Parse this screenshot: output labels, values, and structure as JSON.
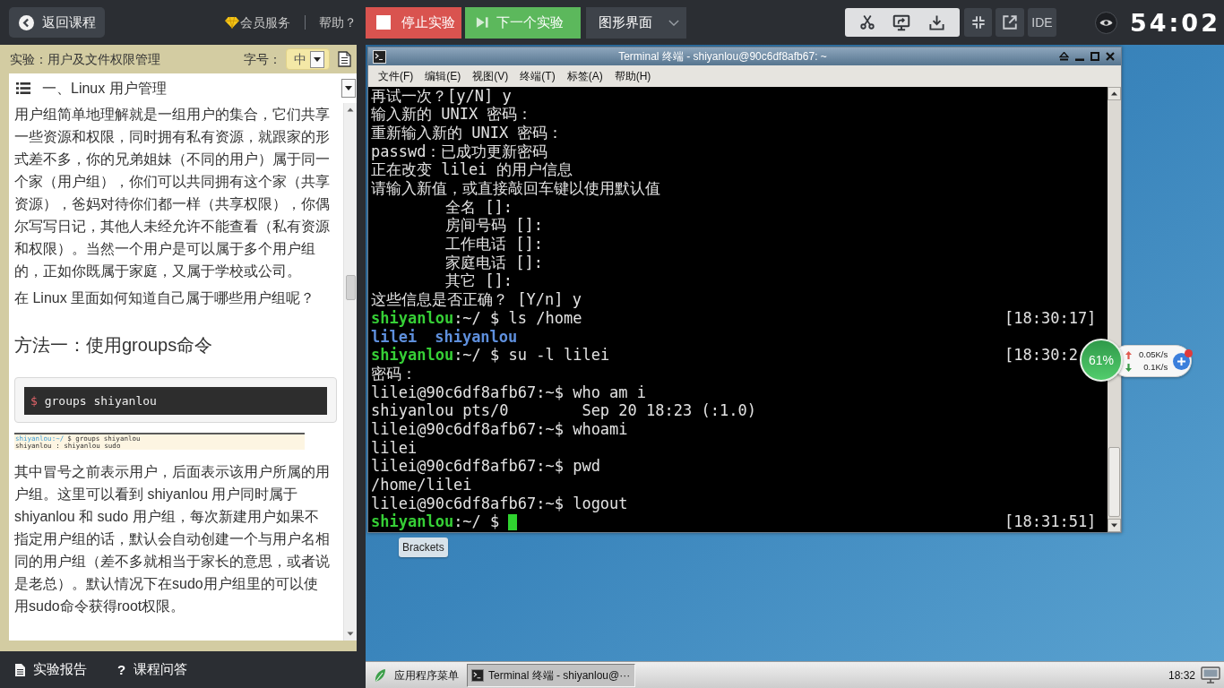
{
  "top_bar": {
    "back_button": "返回课程",
    "vip_link": "会员服务",
    "help_link": "帮助？",
    "stop_button": "停止实验",
    "next_button": "下一个实验",
    "mode_dropdown": "图形界面",
    "ide_button": "IDE",
    "timer": "54:02"
  },
  "lab_panel": {
    "title": "实验：用户及文件权限管理",
    "font_size_label": "字号：",
    "font_size": "中",
    "section": "一、Linux 用户管理",
    "content": [
      {
        "kind": "paragraph",
        "text": "用户组简单地理解就是一组用户的集合，它们共享一些资源和权限，同时拥有私有资源，就跟家的形式差不多，你的兄弟姐妹（不同的用户）属于同一个家（用户组），你们可以共同拥有这个家（共享资源），爸妈对待你们都一样（共享权限），你偶尔写写日记，其他人未经允许不能查看（私有资源和权限）。当然一个用户是可以属于多个用户组的，正如你既属于家庭，又属于学校或公司。"
      },
      {
        "kind": "paragraph",
        "text": "在 Linux 里面如何知道自己属于哪些用户组呢？"
      },
      {
        "kind": "heading",
        "text": "方法一：使用groups命令"
      },
      {
        "kind": "code",
        "prompt": "$",
        "command": "groups shiyanlou"
      },
      {
        "kind": "screenshot",
        "lines": [
          {
            "prompt": "shiyanlou:~/",
            "text": "$ groups shiyanlou"
          },
          {
            "text": "shiyanlou : shiyanlou sudo"
          }
        ]
      },
      {
        "kind": "paragraph",
        "text": "其中冒号之前表示用户，后面表示该用户所属的用户组。这里可以看到 shiyanlou 用户同时属于 shiyanlou 和 sudo 用户组，每次新建用户如果不指定用户组的话，默认会自动创建一个与用户名相同的用户组（差不多就相当于家长的意思，或者说是老总）。默认情况下在sudo用户组里的可以使用sudo命令获得root权限。"
      }
    ]
  },
  "terminal": {
    "title": "Terminal 终端 - shiyanlou@90c6df8afb67: ~",
    "menu": [
      "文件(F)",
      "编辑(E)",
      "视图(V)",
      "终端(T)",
      "标签(A)",
      "帮助(H)"
    ],
    "lines": [
      {
        "kind": "output",
        "text": "再试一次？[y/N] y"
      },
      {
        "kind": "output",
        "text": "输入新的 UNIX 密码："
      },
      {
        "kind": "output",
        "text": "重新输入新的 UNIX 密码："
      },
      {
        "kind": "output",
        "text": "passwd：已成功更新密码"
      },
      {
        "kind": "output",
        "text": "正在改变 lilei 的用户信息"
      },
      {
        "kind": "output",
        "text": "请输入新值，或直接敲回车键以使用默认值"
      },
      {
        "kind": "field",
        "text": "全名 []:"
      },
      {
        "kind": "field",
        "text": "房间号码 []:"
      },
      {
        "kind": "field",
        "text": "工作电话 []:"
      },
      {
        "kind": "field",
        "text": "家庭电话 []:"
      },
      {
        "kind": "field",
        "text": "其它 []:"
      },
      {
        "kind": "output",
        "text": "这些信息是否正确？ [Y/n] y"
      },
      {
        "kind": "prompt",
        "user": "shiyanlou",
        "text": ":~/ $ ls /home",
        "time": "[18:30:17]"
      },
      {
        "kind": "listing",
        "items": [
          "lilei",
          "shiyanlou"
        ]
      },
      {
        "kind": "prompt",
        "user": "shiyanlou",
        "text": ":~/ $ su -l lilei",
        "time": "[18:30:2"
      },
      {
        "kind": "output",
        "text": "密码："
      },
      {
        "kind": "output",
        "text": "lilei@90c6df8afb67:~$ who am i"
      },
      {
        "kind": "output",
        "text": "shiyanlou pts/0        Sep 20 18:23 (:1.0)"
      },
      {
        "kind": "output",
        "text": "lilei@90c6df8afb67:~$ whoami"
      },
      {
        "kind": "output",
        "text": "lilei"
      },
      {
        "kind": "output",
        "text": "lilei@90c6df8afb67:~$ pwd"
      },
      {
        "kind": "output",
        "text": "/home/lilei"
      },
      {
        "kind": "output",
        "text": "lilei@90c6df8afb67:~$ logout"
      },
      {
        "kind": "prompt",
        "user": "shiyanlou",
        "text": ":~/ $",
        "time": "[18:31:51]",
        "cursor": true
      }
    ]
  },
  "desktop": {
    "icons": [
      {
        "label": "Brackets"
      }
    ],
    "network_monitor": {
      "usage": "61%",
      "upload": "0.05K/s",
      "download": "0.1K/s"
    }
  },
  "lab_footer": [
    {
      "kind": "report",
      "label": "实验报告"
    },
    {
      "kind": "qa",
      "icon": "?",
      "label": "课程问答"
    }
  ],
  "taskbar": {
    "app_menu": "应用程序菜单",
    "tasks": [
      {
        "label": "Terminal 终端 - shiyanlou@···",
        "selected": true
      }
    ],
    "clock": "18:32"
  }
}
